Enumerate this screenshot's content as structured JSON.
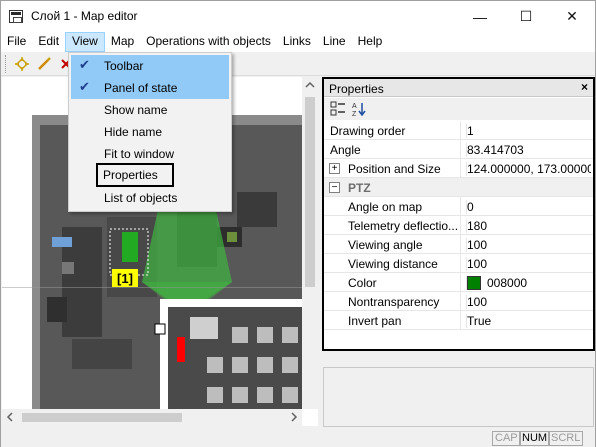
{
  "window": {
    "title": "Слой 1 - Map editor",
    "minimize": "—",
    "maximize": "☐",
    "close": "✕"
  },
  "menu": [
    "File",
    "Edit",
    "View",
    "Map",
    "Operations with objects",
    "Links",
    "Line",
    "Help"
  ],
  "view_menu": {
    "items": [
      {
        "label": "Toolbar",
        "checked": true
      },
      {
        "label": "Panel of state",
        "checked": true
      },
      {
        "label": "Show name",
        "checked": false
      },
      {
        "label": "Hide name",
        "checked": false
      },
      {
        "label": "Fit to window",
        "checked": false
      },
      {
        "label": "Properties",
        "checked": false,
        "highlighted_box": true
      },
      {
        "label": "List of objects",
        "checked": false
      }
    ]
  },
  "toolbar": {
    "icons": [
      "add-point-icon",
      "pencil-icon",
      "delete-icon"
    ]
  },
  "map": {
    "camera_label": "[1]",
    "camera_label_color": "#ffff00",
    "fov_color": "#2aa82a"
  },
  "properties": {
    "title": "Properties",
    "close": "×",
    "rows": [
      {
        "name": "Drawing order",
        "value": "1"
      },
      {
        "name": "Angle",
        "value": "83.414703"
      },
      {
        "name": "Position and Size",
        "value": "124.000000, 173.00000...",
        "expander": "+"
      },
      {
        "name": "PTZ",
        "group": true,
        "expander": "−"
      },
      {
        "name": "Angle on map",
        "value": "0",
        "indent": true
      },
      {
        "name": "Telemetry deflectio...",
        "value": "180",
        "indent": true
      },
      {
        "name": "Viewing angle",
        "value": "100",
        "indent": true
      },
      {
        "name": "Viewing distance",
        "value": "100",
        "indent": true
      },
      {
        "name": "Color",
        "value": "008000",
        "indent": true,
        "swatch": "#008000"
      },
      {
        "name": "Nontransparency",
        "value": "100",
        "indent": true
      },
      {
        "name": "Invert pan",
        "value": "True",
        "indent": true
      }
    ]
  },
  "status": {
    "cap": "CAP",
    "num": "NUM",
    "scrl": "SCRL"
  }
}
